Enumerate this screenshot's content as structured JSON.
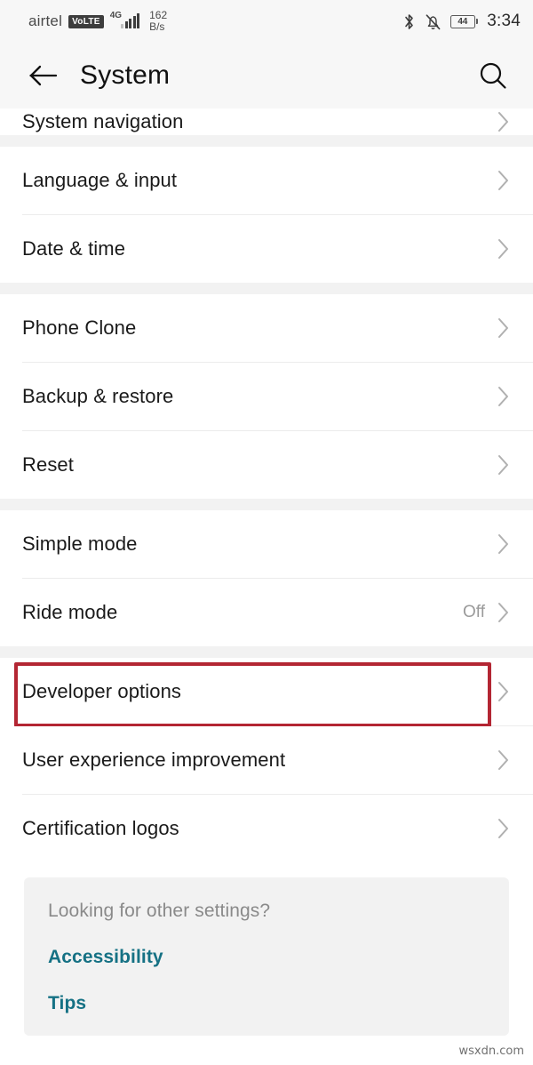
{
  "status_bar": {
    "carrier": "airtel",
    "volte_badge": "VoLTE",
    "network_type": "4G",
    "data_speed_value": "162",
    "data_speed_unit": "B/s",
    "battery_percent": "44",
    "clock": "3:34",
    "icons": [
      "bluetooth-icon",
      "bell-muted-icon",
      "battery-icon"
    ]
  },
  "app_bar": {
    "title": "System",
    "back_icon": "back-arrow-icon",
    "search_icon": "search-icon"
  },
  "colors": {
    "accent_link": "#157184",
    "highlight_box": "#b32633",
    "section_gap": "#f2f2f2",
    "card_background": "#f2f2f2",
    "chevron": "#b0b0b0"
  },
  "sections": [
    {
      "rows": [
        {
          "label": "System navigation",
          "value": "",
          "clipped": true,
          "highlighted": false
        }
      ]
    },
    {
      "rows": [
        {
          "label": "Language & input",
          "value": "",
          "clipped": false,
          "highlighted": false
        },
        {
          "label": "Date & time",
          "value": "",
          "clipped": false,
          "highlighted": false
        }
      ]
    },
    {
      "rows": [
        {
          "label": "Phone Clone",
          "value": "",
          "clipped": false,
          "highlighted": false
        },
        {
          "label": "Backup & restore",
          "value": "",
          "clipped": false,
          "highlighted": false
        },
        {
          "label": "Reset",
          "value": "",
          "clipped": false,
          "highlighted": false
        }
      ]
    },
    {
      "rows": [
        {
          "label": "Simple mode",
          "value": "",
          "clipped": false,
          "highlighted": false
        },
        {
          "label": "Ride mode",
          "value": "Off",
          "clipped": false,
          "highlighted": false
        }
      ]
    },
    {
      "rows": [
        {
          "label": "Developer options",
          "value": "",
          "clipped": false,
          "highlighted": true
        },
        {
          "label": "User experience improvement",
          "value": "",
          "clipped": false,
          "highlighted": false
        },
        {
          "label": "Certification logos",
          "value": "",
          "clipped": false,
          "highlighted": false
        }
      ]
    }
  ],
  "other_settings_card": {
    "title": "Looking for other settings?",
    "links": [
      {
        "label": "Accessibility"
      },
      {
        "label": "Tips"
      }
    ]
  },
  "watermark": "wsxdn.com"
}
